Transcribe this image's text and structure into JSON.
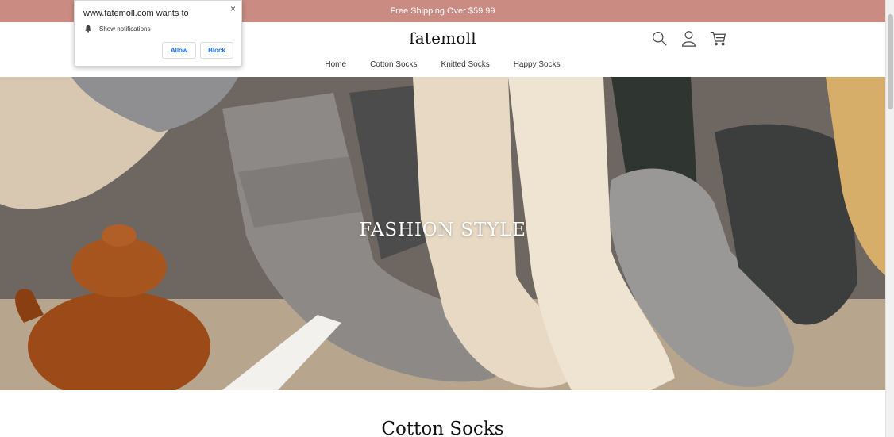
{
  "promo": {
    "text": "Free Shipping Over $59.99"
  },
  "header": {
    "logo": "fatemoll",
    "icons": [
      "search-icon",
      "account-icon",
      "cart-icon"
    ]
  },
  "nav": {
    "items": [
      {
        "label": "Home"
      },
      {
        "label": "Cotton Socks"
      },
      {
        "label": "Knitted Socks"
      },
      {
        "label": "Happy Socks"
      }
    ]
  },
  "hero": {
    "title": "FASHION STYLE"
  },
  "section": {
    "title": "Cotton Socks"
  },
  "notification": {
    "title": "www.fatemoll.com wants to",
    "permission": "Show notifications",
    "close": "×",
    "allow": "Allow",
    "block": "Block"
  },
  "colors": {
    "promo_bg": "#c98b82",
    "accent_blue": "#1a73e8"
  }
}
